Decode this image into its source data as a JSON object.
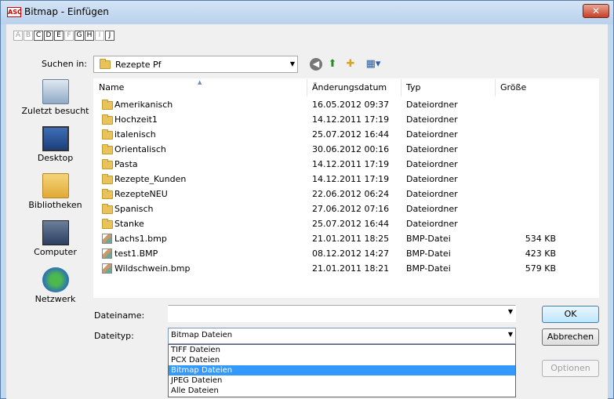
{
  "window": {
    "title": "Bitmap - Einfügen",
    "app_icon_text": "ASC",
    "close_glyph": "✕"
  },
  "letters": [
    {
      "ch": "A",
      "on": false
    },
    {
      "ch": "B",
      "on": false
    },
    {
      "ch": "C",
      "on": true
    },
    {
      "ch": "D",
      "on": true
    },
    {
      "ch": "E",
      "on": true
    },
    {
      "ch": "F",
      "on": false
    },
    {
      "ch": "G",
      "on": true
    },
    {
      "ch": "H",
      "on": true
    },
    {
      "ch": "I",
      "on": false
    },
    {
      "ch": "J",
      "on": true
    }
  ],
  "lookin": {
    "label": "Suchen in:",
    "value": "Rezepte Pf"
  },
  "places": [
    {
      "label": "Zuletzt besucht",
      "icon": "recent-places-icon"
    },
    {
      "label": "Desktop",
      "icon": "desktop-icon"
    },
    {
      "label": "Bibliotheken",
      "icon": "libraries-icon"
    },
    {
      "label": "Computer",
      "icon": "computer-icon"
    },
    {
      "label": "Netzwerk",
      "icon": "network-icon"
    }
  ],
  "columns": {
    "name": "Name",
    "date": "Änderungsdatum",
    "type": "Typ",
    "size": "Größe"
  },
  "files": [
    {
      "name": "Amerikanisch",
      "date": "16.05.2012 09:37",
      "type": "Dateiordner",
      "size": "",
      "kind": "folder"
    },
    {
      "name": "Hochzeit1",
      "date": "14.12.2011 17:19",
      "type": "Dateiordner",
      "size": "",
      "kind": "folder"
    },
    {
      "name": "italenisch",
      "date": "25.07.2012 16:44",
      "type": "Dateiordner",
      "size": "",
      "kind": "folder"
    },
    {
      "name": "Orientalisch",
      "date": "30.06.2012 00:16",
      "type": "Dateiordner",
      "size": "",
      "kind": "folder"
    },
    {
      "name": "Pasta",
      "date": "14.12.2011 17:19",
      "type": "Dateiordner",
      "size": "",
      "kind": "folder"
    },
    {
      "name": "Rezepte_Kunden",
      "date": "14.12.2011 17:19",
      "type": "Dateiordner",
      "size": "",
      "kind": "folder"
    },
    {
      "name": "RezepteNEU",
      "date": "22.06.2012 06:24",
      "type": "Dateiordner",
      "size": "",
      "kind": "folder"
    },
    {
      "name": "Spanisch",
      "date": "27.06.2012 07:16",
      "type": "Dateiordner",
      "size": "",
      "kind": "folder"
    },
    {
      "name": "Stanke",
      "date": "25.07.2012 16:44",
      "type": "Dateiordner",
      "size": "",
      "kind": "folder"
    },
    {
      "name": "Lachs1.bmp",
      "date": "21.01.2011 18:25",
      "type": "BMP-Datei",
      "size": "534 KB",
      "kind": "bmp"
    },
    {
      "name": "test1.BMP",
      "date": "08.12.2012 14:27",
      "type": "BMP-Datei",
      "size": "423 KB",
      "kind": "bmp"
    },
    {
      "name": "Wildschwein.bmp",
      "date": "21.01.2011 18:21",
      "type": "BMP-Datei",
      "size": "579 KB",
      "kind": "bmp"
    }
  ],
  "filename": {
    "label": "Dateiname:",
    "value": ""
  },
  "filetype": {
    "label": "Dateityp:",
    "value": "Bitmap Dateien",
    "options": [
      "TIFF Dateien",
      "PCX Dateien",
      "Bitmap Dateien",
      "JPEG Dateien",
      "Alle Dateien"
    ],
    "selected_index": 2
  },
  "buttons": {
    "ok": "OK",
    "cancel": "Abbrechen",
    "options": "Optionen"
  }
}
